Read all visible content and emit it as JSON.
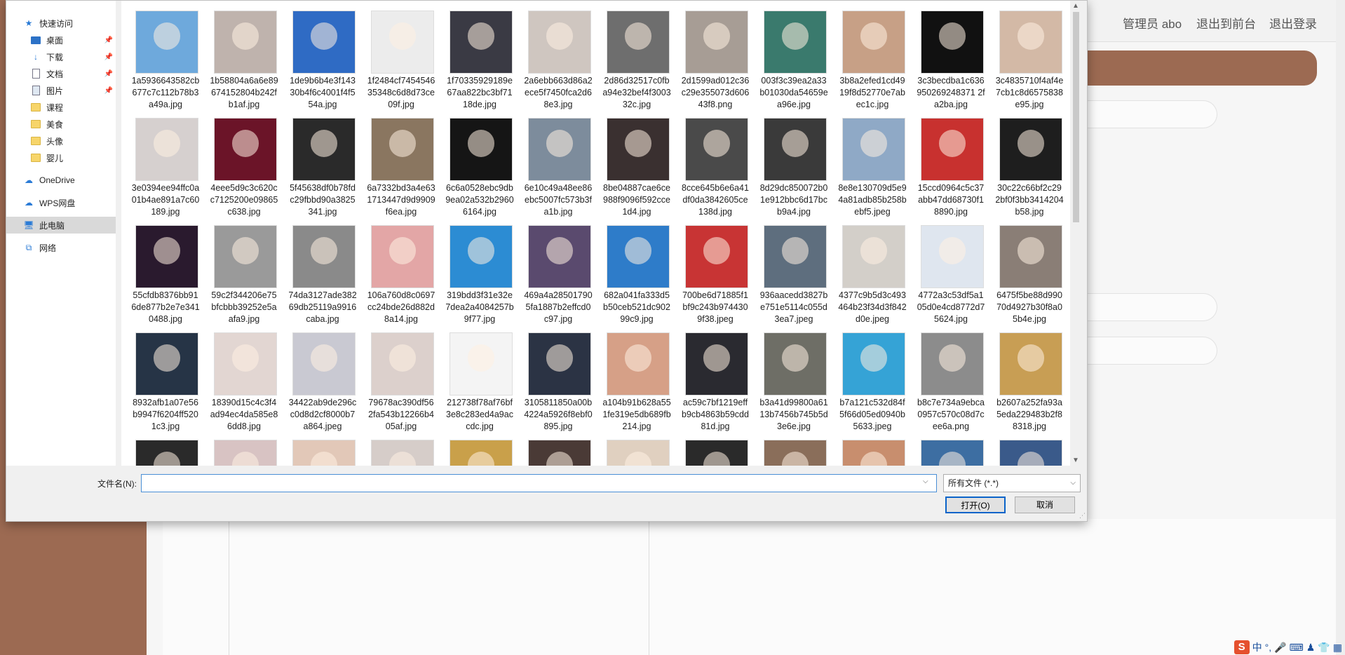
{
  "background_page": {
    "top_links": [
      "管理员 abo",
      "退出到前台",
      "退出登录"
    ]
  },
  "dialog": {
    "nav": [
      {
        "label": "快速访问",
        "icon": "star-icon",
        "level": "top"
      },
      {
        "label": "桌面",
        "icon": "desktop-icon",
        "level": "sub",
        "pinned": true
      },
      {
        "label": "下载",
        "icon": "download-icon",
        "level": "sub",
        "pinned": true
      },
      {
        "label": "文档",
        "icon": "document-icon",
        "level": "sub",
        "pinned": true
      },
      {
        "label": "图片",
        "icon": "pictures-icon",
        "level": "sub",
        "pinned": true
      },
      {
        "label": "课程",
        "icon": "folder-icon",
        "level": "sub"
      },
      {
        "label": "美食",
        "icon": "folder-icon",
        "level": "sub"
      },
      {
        "label": "头像",
        "icon": "folder-icon",
        "level": "sub"
      },
      {
        "label": "婴儿",
        "icon": "folder-icon",
        "level": "sub"
      },
      {
        "label": "OneDrive",
        "icon": "cloud-icon",
        "level": "top"
      },
      {
        "label": "WPS网盘",
        "icon": "cloud-icon",
        "level": "top"
      },
      {
        "label": "此电脑",
        "icon": "computer-icon",
        "level": "top",
        "selected": true
      },
      {
        "label": "网络",
        "icon": "network-icon",
        "level": "top"
      }
    ],
    "files": [
      {
        "name": "1a5936643582cb677c7c112b78b3a49a.jpg",
        "color": "#6ea9dc"
      },
      {
        "name": "1b58804a6a6e89674152804b242fb1af.jpg",
        "color": "#bfb3ad"
      },
      {
        "name": "1de9b6b4e3f14330b4f6c4001f4f554a.jpg",
        "color": "#2f6bc4"
      },
      {
        "name": "1f2484cf745454635348c6d8d73ce09f.jpg",
        "color": "#ececec"
      },
      {
        "name": "1f70335929189e67aa822bc3bf7118de.jpg",
        "color": "#3a3a44"
      },
      {
        "name": "2a6ebb663d86a2ece5f7450fca2d68e3.jpg",
        "color": "#cfc6c0"
      },
      {
        "name": "2d86d32517c0fba94e32bef4f300332c.jpg",
        "color": "#6e6e6e"
      },
      {
        "name": "2d1599ad012c36c29e355073d60643f8.png",
        "color": "#a79d95"
      },
      {
        "name": "003f3c39ea2a33b01030da54659ea96e.jpg",
        "color": "#3a7a6d"
      },
      {
        "name": "3b8a2efed1cd4919f8d52770e7abec1c.jpg",
        "color": "#c7a086"
      },
      {
        "name": "3c3becdba1c636950269248371 2fa2ba.jpg",
        "color": "#111111"
      },
      {
        "name": "3c4835710f4af4e7cb1c8d6575838e95.jpg",
        "color": "#d3b9a6"
      },
      {
        "name": "3e0394ee94ffc0a01b4ae891a7c60189.jpg",
        "color": "#d6d0cf"
      },
      {
        "name": "4eee5d9c3c620cc7125200e09865c638.jpg",
        "color": "#6b1428"
      },
      {
        "name": "5f45638df0b78fdc29fbbd90a3825341.jpg",
        "color": "#2a2a2a"
      },
      {
        "name": "6a7332bd3a4e631713447d9d9909f6ea.jpg",
        "color": "#8a7660"
      },
      {
        "name": "6c6a0528ebc9db9ea02a532b29606164.jpg",
        "color": "#151515"
      },
      {
        "name": "6e10c49a48ee86ebc5007fc573b3fa1b.jpg",
        "color": "#7d8c9c"
      },
      {
        "name": "8be04887cae6ce988f9096f592cce1d4.jpg",
        "color": "#3a3030"
      },
      {
        "name": "8cce645b6e6a41df0da3842605ce138d.jpg",
        "color": "#4a4a4a"
      },
      {
        "name": "8d29dc850072b01e912bbc6d17bcb9a4.jpg",
        "color": "#3a3a3a"
      },
      {
        "name": "8e8e130709d5e94a81adb85b258bebf5.jpeg",
        "color": "#8fa9c6"
      },
      {
        "name": "15ccd0964c5c37abb47dd68730f18890.jpg",
        "color": "#c8312f"
      },
      {
        "name": "30c22c66bf2c292bf0f3bb3414204b58.jpg",
        "color": "#1e1e1e"
      },
      {
        "name": "55cfdb8376bb916de877b2e7e3410488.jpg",
        "color": "#2a1a2e"
      },
      {
        "name": "59c2f344206e75bfcbbb39252e5aafa9.jpg",
        "color": "#9a9a9a"
      },
      {
        "name": "74da3127ade38269db25119a9916caba.jpg",
        "color": "#8a8a8a"
      },
      {
        "name": "106a760d8c0697cc24bde26d882d8a14.jpg",
        "color": "#e3a6a6"
      },
      {
        "name": "319bdd3f31e32e7dea2a4084257b9f77.jpg",
        "color": "#2c8cd3"
      },
      {
        "name": "469a4a285017905fa1887b2effcd0c97.jpg",
        "color": "#5a4a6e"
      },
      {
        "name": "682a041fa333d5b50ceb521dc90299c9.jpg",
        "color": "#2e7cc9"
      },
      {
        "name": "700be6d71885f1bf9c243b9744309f38.jpeg",
        "color": "#c83434"
      },
      {
        "name": "936aacedd3827be751e5114c055d3ea7.jpeg",
        "color": "#5e6e7e"
      },
      {
        "name": "4377c9b5d3c493464b23f34d3f842d0e.jpeg",
        "color": "#d3cfc9"
      },
      {
        "name": "4772a3c53df5a105d0e4cd8772d75624.jpg",
        "color": "#dfe6ef"
      },
      {
        "name": "6475f5be88d99070d4927b30f8a05b4e.jpg",
        "color": "#8a7e76"
      },
      {
        "name": "8932afb1a07e56b9947f6204ff5201c3.jpg",
        "color": "#263446"
      },
      {
        "name": "18390d15c4c3f4ad94ec4da585e86dd8.jpg",
        "color": "#e2d6d2"
      },
      {
        "name": "34422ab9de296cc0d8d2cf8000b7a864.jpeg",
        "color": "#c9c9d2"
      },
      {
        "name": "79678ac390df562fa543b12266b405af.jpg",
        "color": "#dcd0cc"
      },
      {
        "name": "212738f78af76bf3e8c283ed4a9accdc.jpg",
        "color": "#f4f4f4"
      },
      {
        "name": "3105811850a00b4224a5926f8ebf0895.jpg",
        "color": "#2b3344"
      },
      {
        "name": "a104b91b628a551fe319e5db689fb214.jpg",
        "color": "#d6a087"
      },
      {
        "name": "ac59c7bf1219effb9cb4863b59cdd81d.jpg",
        "color": "#2a2a30"
      },
      {
        "name": "b3a41d99800a6113b7456b745b5d3e6e.jpg",
        "color": "#6e6e66"
      },
      {
        "name": "b7a121c532d84f5f66d05ed0940b5633.jpeg",
        "color": "#35a3d6"
      },
      {
        "name": "b8c7e734a9ebca0957c570c08d7cee6a.png",
        "color": "#8c8c8c"
      },
      {
        "name": "b2607a252fa93a5eda229483b2f88318.jpg",
        "color": "#c89e54"
      },
      {
        "name": "",
        "color": "#2a2a2a"
      },
      {
        "name": "",
        "color": "#d8c3c3"
      },
      {
        "name": "",
        "color": "#e2c8b8"
      },
      {
        "name": "",
        "color": "#d6cdc9"
      },
      {
        "name": "",
        "color": "#c9a04a"
      },
      {
        "name": "",
        "color": "#4a3a36"
      },
      {
        "name": "",
        "color": "#e0d0c0"
      },
      {
        "name": "",
        "color": "#2a2a2a"
      },
      {
        "name": "",
        "color": "#8a6e5a"
      },
      {
        "name": "",
        "color": "#c88e6e"
      },
      {
        "name": "",
        "color": "#3d6ea2"
      },
      {
        "name": "",
        "color": "#3a5a8a"
      }
    ],
    "filename_label": "文件名(N):",
    "filename_value": "",
    "filetype_value": "所有文件 (*.*)",
    "open_label": "打开(O)",
    "cancel_label": "取消"
  },
  "tray": {
    "s_label": "S",
    "ime_label": "中"
  }
}
